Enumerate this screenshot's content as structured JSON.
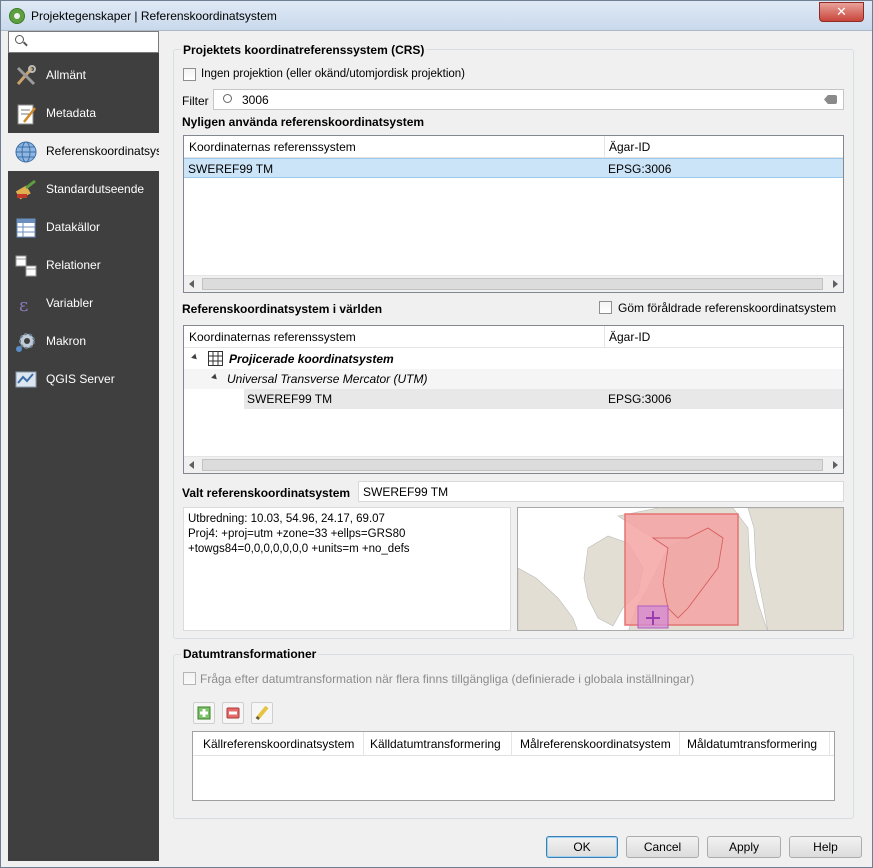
{
  "window": {
    "title": "Projektegenskaper | Referenskoordinatsystem",
    "close_label": "✕"
  },
  "sidebar": {
    "search_placeholder": "",
    "items": [
      {
        "label": "Allmänt",
        "icon": "tools-icon"
      },
      {
        "label": "Metadata",
        "icon": "metadata-icon"
      },
      {
        "label": "Referenskoordinatsystem",
        "icon": "globe-icon",
        "active": true
      },
      {
        "label": "Standardutseende",
        "icon": "paint-icon"
      },
      {
        "label": "Datakällor",
        "icon": "table-icon"
      },
      {
        "label": "Relationer",
        "icon": "relations-icon"
      },
      {
        "label": "Variabler",
        "icon": "variable-icon"
      },
      {
        "label": "Makron",
        "icon": "gear-icon"
      },
      {
        "label": "QGIS Server",
        "icon": "server-icon"
      }
    ]
  },
  "crs": {
    "group_title": "Projektets koordinatreferenssystem (CRS)",
    "no_projection_label": "Ingen projektion (eller okänd/utomjordisk projektion)",
    "filter_label": "Filter",
    "filter_value": "3006",
    "recent_title": "Nyligen använda referenskoordinatsystem",
    "recent_headers": [
      "Koordinaternas referenssystem",
      "Ägar-ID"
    ],
    "recent_rows": [
      {
        "name": "SWEREF99 TM",
        "id": "EPSG:3006"
      }
    ],
    "world_title": "Referenskoordinatsystem i världen",
    "hide_deprecated_label": "Göm föråldrade referenskoordinatsystem",
    "world_headers": [
      "Koordinaternas referenssystem",
      "Ägar-ID"
    ],
    "tree": {
      "level1": "Projicerade koordinatsystem",
      "level2": "Universal Transverse Mercator (UTM)",
      "leaf_name": "SWEREF99 TM",
      "leaf_id": "EPSG:3006"
    },
    "selected_label": "Valt referenskoordinatsystem",
    "selected_value": "SWEREF99 TM",
    "info_line1": "Utbredning: 10.03, 54.96, 24.17, 69.07",
    "info_line2": "Proj4: +proj=utm +zone=33 +ellps=GRS80",
    "info_line3": "+towgs84=0,0,0,0,0,0,0 +units=m +no_defs"
  },
  "datum": {
    "group_title": "Datumtransformationer",
    "ask_label": "Fråga efter datumtransformation när flera finns tillgängliga (definierade i globala inställningar)",
    "headers": [
      "Källreferenskoordinatsystem",
      "Källdatumtransformering",
      "Målreferenskoordinatsystem",
      "Måldatumtransformering"
    ]
  },
  "buttons": {
    "ok": "OK",
    "cancel": "Cancel",
    "apply": "Apply",
    "help": "Help"
  },
  "colors": {
    "sidebar_bg": "#3f3f3f",
    "selection": "#cce4f7",
    "extent_fill": "#f4a3a3",
    "land": "#e3ded3",
    "sea": "#ffffff"
  }
}
